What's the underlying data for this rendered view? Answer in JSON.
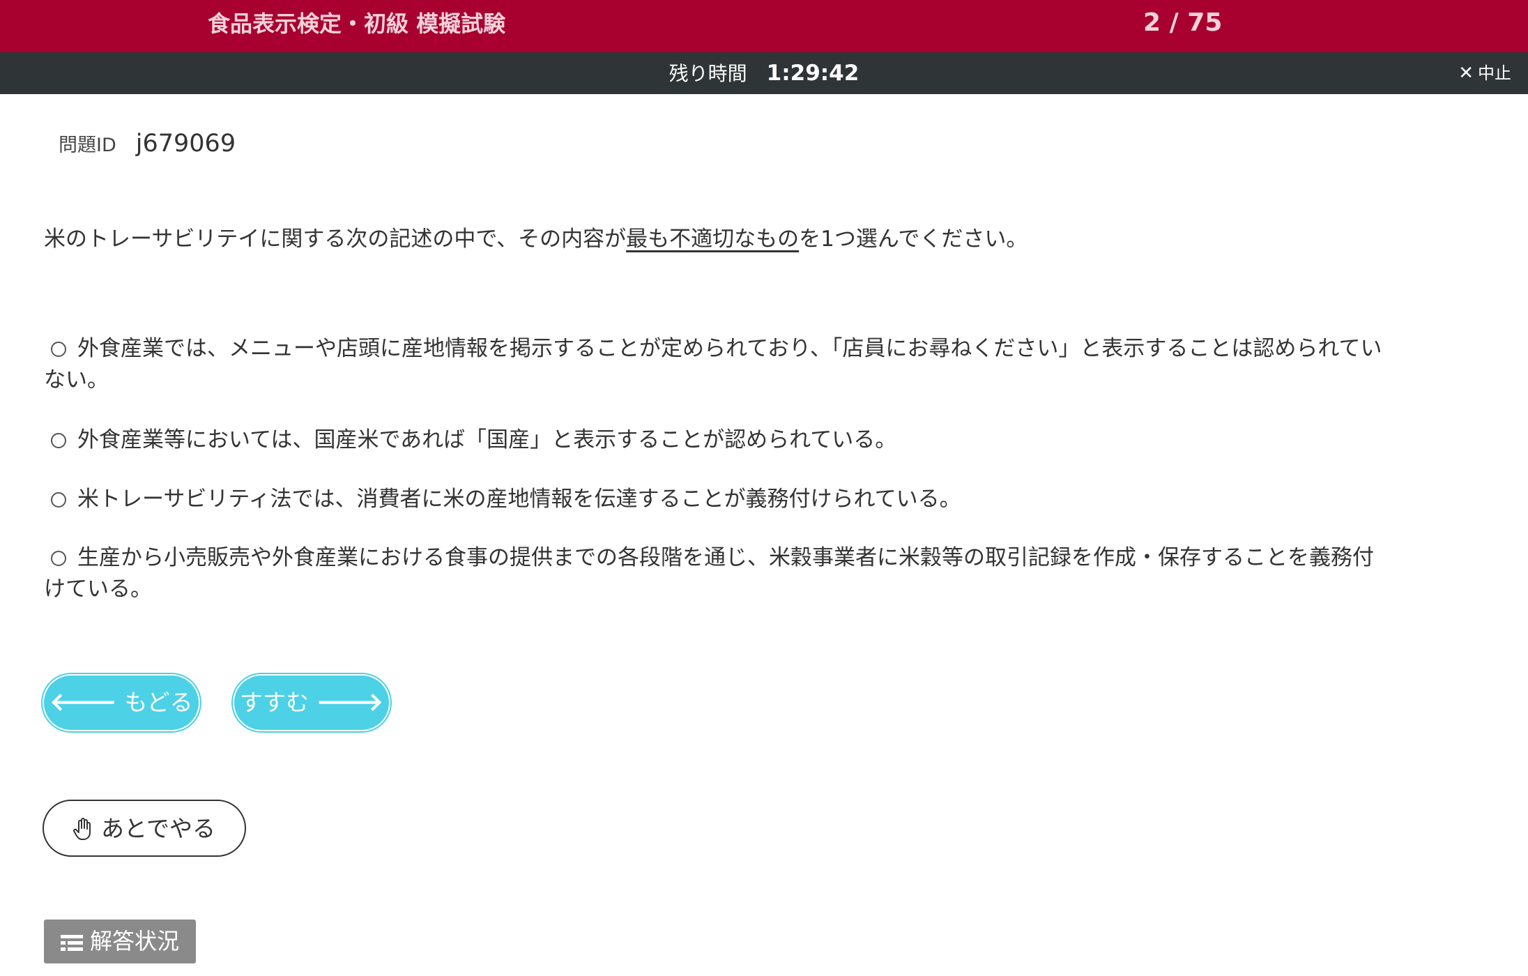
{
  "header": {
    "exam_title": "食品表示検定・初級 模擬試験",
    "progress": "2 / 75",
    "background_color": "#a8002f"
  },
  "timer_bar": {
    "label": "残り時間",
    "remaining": "1:29:42",
    "quit_icon": "close-icon",
    "quit_label": "中止"
  },
  "question": {
    "id_label": "問題ID",
    "id_value": "j679069",
    "text_before": "米のトレーサビリテイに関する次の記述の中で、その内容が",
    "text_emphasis": "最も不適切なもの",
    "text_after": "を1つ選んでください。"
  },
  "choices": [
    {
      "text": "外食産業では、メニューや店頭に産地情報を掲示することが定められており、「店員にお尋ねください」と表示することは認められていない。",
      "selected": false
    },
    {
      "text": "外食産業等においては、国産米であれば「国産」と表示することが認められている。",
      "selected": false
    },
    {
      "text": "米トレーサビリティ法では、消費者に米の産地情報を伝達することが義務付けられている。",
      "selected": false
    },
    {
      "text": "生産から小売販売や外食産業における食事の提供までの各段階を通じ、米穀事業者に米穀等の取引記録を作成・保存することを義務付けている。",
      "selected": false
    }
  ],
  "navigation": {
    "back_label": "もどる",
    "back_icon": "arrow-left-icon",
    "next_label": "すすむ",
    "next_icon": "arrow-right-icon",
    "button_color": "#4cd1e6"
  },
  "later": {
    "label": "あとでやる",
    "icon": "hand-icon"
  },
  "status": {
    "label": "解答状況",
    "icon": "list-icon",
    "color": "#8a8a8a"
  }
}
